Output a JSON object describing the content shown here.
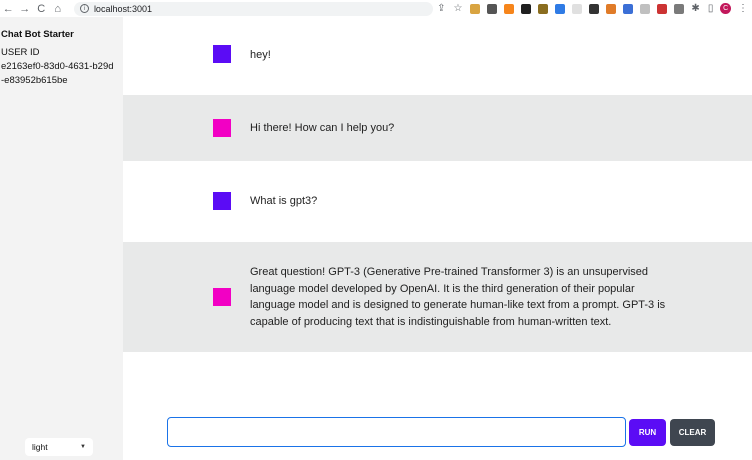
{
  "browser": {
    "back_icon": "←",
    "forward_icon": "→",
    "reload_icon": "C",
    "home_icon": "⌂",
    "url": "localhost:3001",
    "share_icon": "⇪",
    "star_icon": "☆",
    "extensions_icon": "✱",
    "sidepanel_icon": "▯",
    "profile_initial": "C",
    "menu_icon": "⋮",
    "ext_colors": [
      "#d9a441",
      "#555555",
      "#f6851b",
      "#1f1f1f",
      "#8a6d1f",
      "#2f7be5",
      "#e0e0e0",
      "#333333",
      "#e07b28",
      "#3b6fd6",
      "#c0c0c0",
      "#cc3333",
      "#7a7a7a"
    ]
  },
  "sidebar": {
    "app_title": "Chat Bot Starter",
    "user_label": "USER ID",
    "user_id": "e2163ef0-83d0-4631-b29d-e83952b615be",
    "theme_value": "light",
    "theme_caret": "▼"
  },
  "messages": [
    {
      "role": "user",
      "color": "#5b0cf5",
      "text": "hey!"
    },
    {
      "role": "assistant",
      "color": "#f200c4",
      "text": "Hi there! How can I help you?"
    },
    {
      "role": "user",
      "color": "#5b0cf5",
      "text": "What is gpt3?"
    },
    {
      "role": "assistant",
      "color": "#f200c4",
      "text": "Great question! GPT-3 (Generative Pre-trained Transformer 3) is an unsupervised language model developed by OpenAI. It is the third generation of their popular language model and is designed to generate human-like text from a prompt. GPT-3 is capable of producing text that is indistinguishable from human-written text."
    }
  ],
  "composer": {
    "input_value": "",
    "run_label": "RUN",
    "clear_label": "CLEAR"
  }
}
